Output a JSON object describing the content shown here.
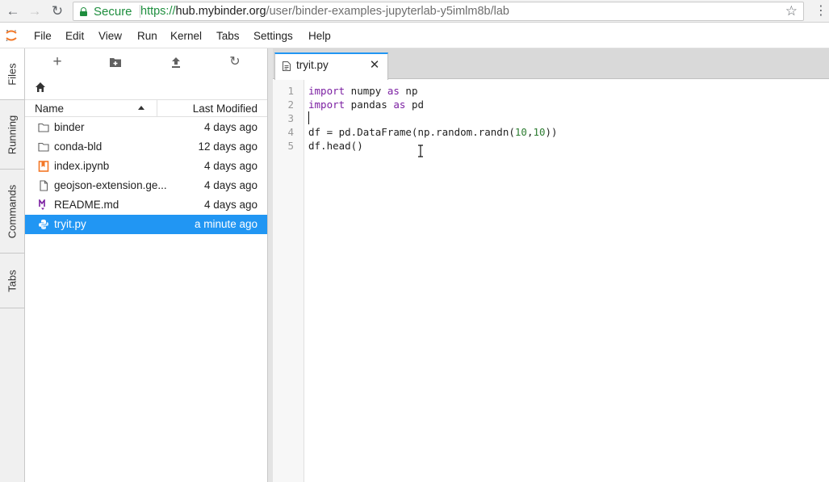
{
  "browser": {
    "secure_label": "Secure",
    "url_scheme": "https://",
    "url_host": "hub.mybinder.org",
    "url_path": "/user/binder-examples-jupyterlab-y5imlm8b/lab",
    "icons": [
      "back-arrow-icon",
      "forward-arrow-icon",
      "reload-icon",
      "lock-icon",
      "star-icon",
      "kebab-menu-icon"
    ]
  },
  "menubar": {
    "items": [
      "File",
      "Edit",
      "View",
      "Run",
      "Kernel",
      "Tabs",
      "Settings",
      "Help"
    ]
  },
  "left_tabs": [
    "Files",
    "Running",
    "Commands",
    "Tabs"
  ],
  "filebrowser": {
    "columns": {
      "name": "Name",
      "modified": "Last Modified"
    },
    "toolbar_icons": [
      "new-launcher-icon",
      "new-folder-icon",
      "upload-icon",
      "refresh-icon"
    ],
    "files": [
      {
        "name": "binder",
        "modified": "4 days ago",
        "kind": "folder"
      },
      {
        "name": "conda-bld",
        "modified": "12 days ago",
        "kind": "folder"
      },
      {
        "name": "index.ipynb",
        "modified": "4 days ago",
        "kind": "notebook"
      },
      {
        "name": "geojson-extension.ge...",
        "modified": "4 days ago",
        "kind": "file"
      },
      {
        "name": "README.md",
        "modified": "4 days ago",
        "kind": "markdown"
      },
      {
        "name": "tryit.py",
        "modified": "a minute ago",
        "kind": "python",
        "selected": true
      }
    ]
  },
  "editor": {
    "tab_label": "tryit.py",
    "line_numbers": [
      "1",
      "2",
      "3",
      "4",
      "5"
    ],
    "lines": [
      [
        {
          "t": "import",
          "c": "kw"
        },
        {
          "t": " numpy ",
          "c": ""
        },
        {
          "t": "as",
          "c": "kw"
        },
        {
          "t": " np",
          "c": ""
        }
      ],
      [
        {
          "t": "import",
          "c": "kw"
        },
        {
          "t": " pandas ",
          "c": ""
        },
        {
          "t": "as",
          "c": "kw"
        },
        {
          "t": " pd",
          "c": ""
        }
      ],
      [],
      [
        {
          "t": "df = pd.DataFrame(np.random.randn(",
          "c": ""
        },
        {
          "t": "10",
          "c": "num"
        },
        {
          "t": ",",
          "c": ""
        },
        {
          "t": "10",
          "c": "num"
        },
        {
          "t": "))",
          "c": ""
        }
      ],
      [
        {
          "t": "df.head()",
          "c": ""
        }
      ]
    ]
  },
  "colors": {
    "accent": "#2196f3",
    "secure_green": "#1e8e3e",
    "jupyter_orange": "#f37726",
    "keyword": "#7b1fa2",
    "number": "#2e7d32"
  }
}
